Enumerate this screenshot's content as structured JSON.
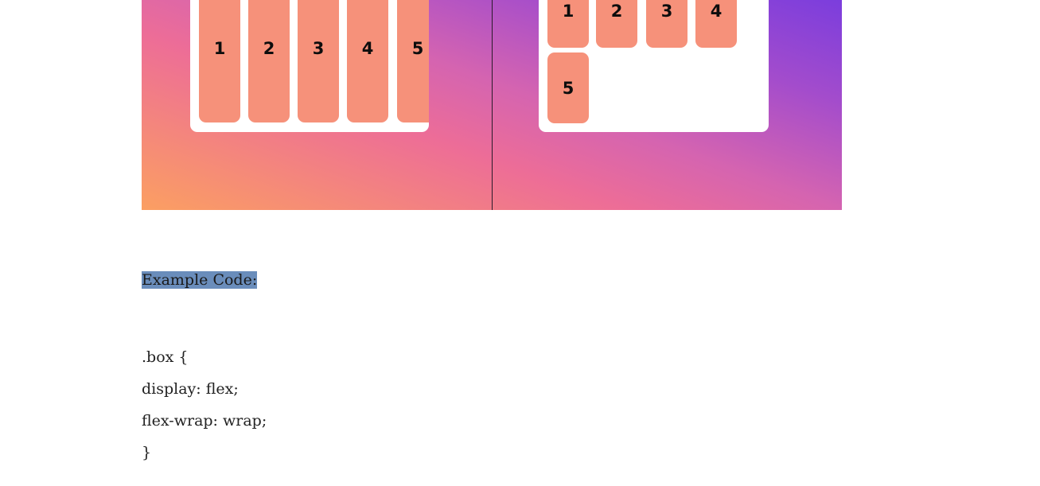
{
  "illustration": {
    "left_panel": {
      "items": [
        "1",
        "2",
        "3",
        "4",
        "5"
      ]
    },
    "right_panel": {
      "items": [
        "1",
        "2",
        "3",
        "4",
        "5"
      ]
    },
    "colors": {
      "gradient_start": "#fb9f62",
      "gradient_mid": "#ed6d97",
      "gradient_end": "#7b3ddd",
      "item_fill": "#f6917a",
      "panel_fill": "#ffffff"
    }
  },
  "content": {
    "example_label": "Example Code:",
    "highlight_color": "#6a8dbb",
    "code_lines": [
      ".box {",
      "display: flex;",
      "flex-wrap: wrap;",
      "}"
    ]
  }
}
